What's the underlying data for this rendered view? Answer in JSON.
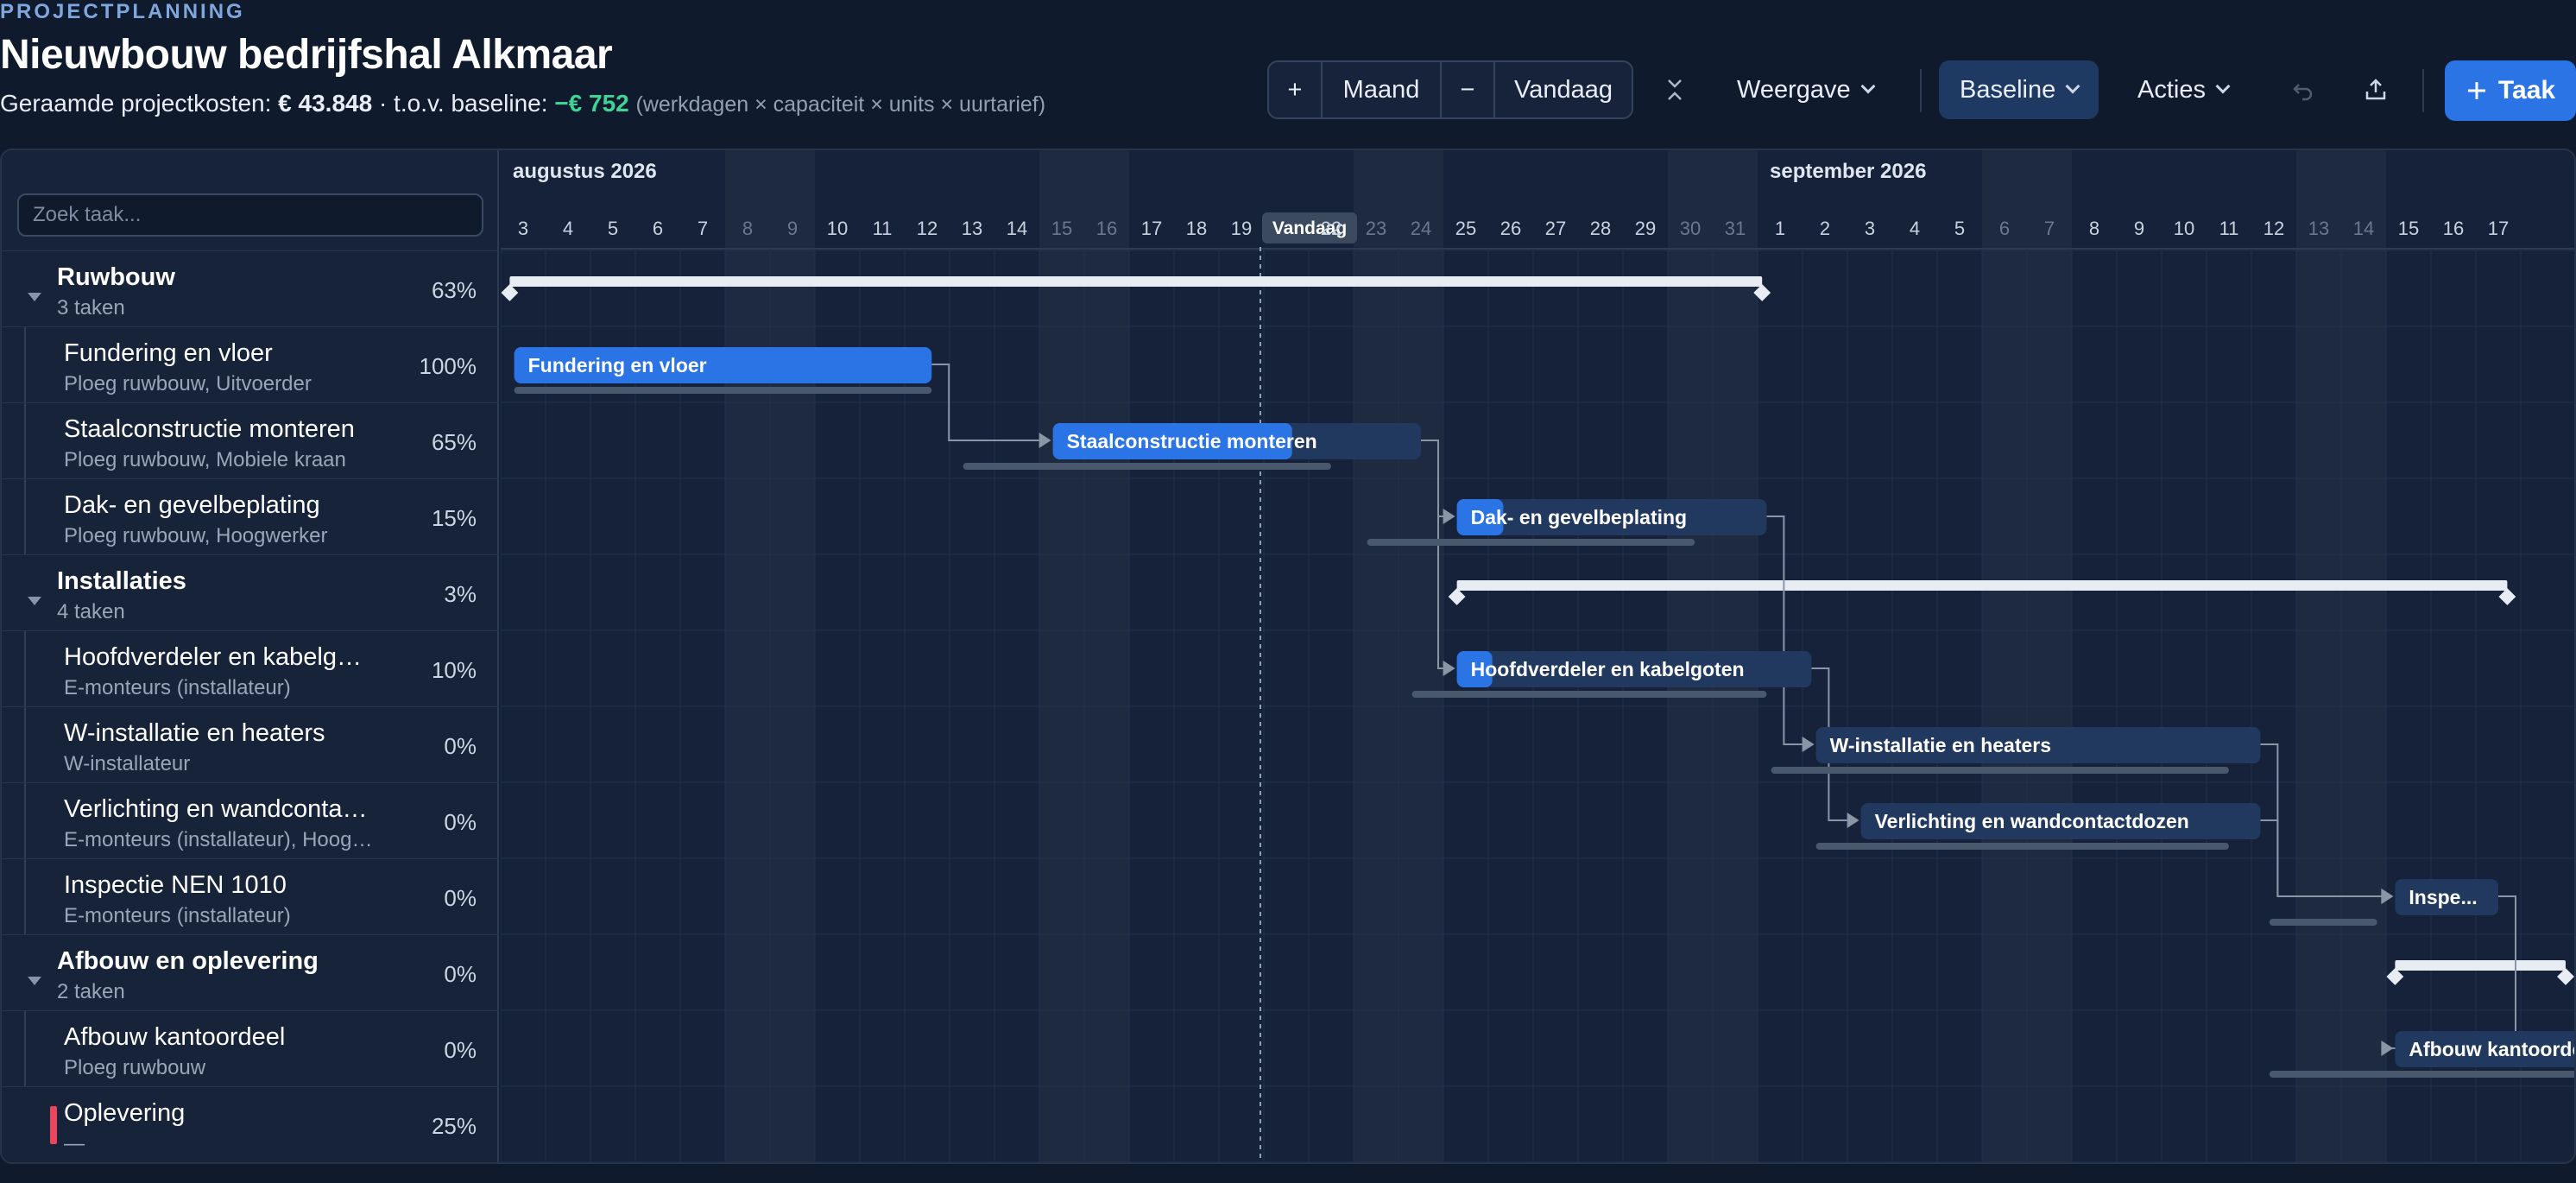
{
  "header": {
    "eyebrow": "PROJECTPLANNING",
    "title": "Nieuwbouw bedrijfshal Alkmaar",
    "cost_label": "Geraamde projectkosten:",
    "cost_value": "€ 43.848",
    "baseline_label": "· t.o.v. baseline:",
    "baseline_delta": "−€ 752",
    "formula": "(werkdagen × capaciteit × units × uurtarief)"
  },
  "toolbar": {
    "zoom_in": "+",
    "scale": "Maand",
    "zoom_out": "−",
    "today": "Vandaag",
    "view": "Weergave",
    "baseline": "Baseline",
    "actions": "Acties",
    "add_task": "Taak"
  },
  "search": {
    "placeholder": "Zoek taak..."
  },
  "timeline": {
    "months": [
      "augustus 2026",
      "september 2026"
    ],
    "days": [
      "3",
      "4",
      "5",
      "6",
      "7",
      "8",
      "9",
      "10",
      "11",
      "12",
      "13",
      "14",
      "15",
      "16",
      "17",
      "18",
      "19",
      "Vandaag",
      "22",
      "23",
      "24",
      "25",
      "26",
      "27",
      "28",
      "29",
      "30",
      "31",
      "1",
      "2",
      "3",
      "4",
      "5",
      "6",
      "7",
      "8",
      "9",
      "10",
      "11",
      "12",
      "13",
      "14",
      "15",
      "16",
      "17"
    ],
    "weekend_day_indices": [
      5,
      6,
      12,
      13,
      19,
      20,
      26,
      27,
      33,
      34,
      40,
      41
    ],
    "today_index": 17
  },
  "rows": [
    {
      "kind": "group",
      "name": "Ruwbouw",
      "sub": "3 taken",
      "pct": "63%"
    },
    {
      "kind": "task",
      "name": "Fundering en vloer",
      "sub": "Ploeg ruwbouw, Uitvoerder",
      "pct": "100%"
    },
    {
      "kind": "task",
      "name": "Staalconstructie monteren",
      "sub": "Ploeg ruwbouw, Mobiele kraan",
      "pct": "65%"
    },
    {
      "kind": "task",
      "name": "Dak- en gevelbeplating",
      "sub": "Ploeg ruwbouw, Hoogwerker",
      "pct": "15%"
    },
    {
      "kind": "group",
      "name": "Installaties",
      "sub": "4 taken",
      "pct": "3%"
    },
    {
      "kind": "task",
      "name": "Hoofdverdeler en kabelgoten",
      "sub": "E-monteurs (installateur)",
      "pct": "10%"
    },
    {
      "kind": "task",
      "name": "W-installatie en heaters",
      "sub": "W-installateur",
      "pct": "0%"
    },
    {
      "kind": "task",
      "name": "Verlichting en wandcontactdozen",
      "sub": "E-monteurs (installateur), Hoogwerker",
      "pct": "0%"
    },
    {
      "kind": "task",
      "name": "Inspectie NEN 1010",
      "sub": "E-monteurs (installateur)",
      "pct": "0%"
    },
    {
      "kind": "group",
      "name": "Afbouw en oplevering",
      "sub": "2 taken",
      "pct": "0%"
    },
    {
      "kind": "task",
      "name": "Afbouw kantoordeel",
      "sub": "Ploeg ruwbouw",
      "pct": "0%"
    },
    {
      "kind": "milestone",
      "name": "Oplevering",
      "sub": "—",
      "pct": "25%"
    }
  ],
  "gantt": {
    "summaries": [
      {
        "row": 0,
        "start": 0.2,
        "end": 28.1
      },
      {
        "row": 4,
        "start": 21.3,
        "end": 44.7
      },
      {
        "row": 9,
        "start": 42.2,
        "end": 46
      }
    ],
    "bars": [
      {
        "row": 1,
        "label": "Fundering en vloer",
        "start": 0.3,
        "end": 9.6,
        "progress": 1.0,
        "base_start": 0.3,
        "base_end": 9.6
      },
      {
        "row": 2,
        "label": "Staalconstructie monteren",
        "start": 12.3,
        "end": 20.5,
        "progress": 0.65,
        "base_start": 10.3,
        "base_end": 18.5
      },
      {
        "row": 3,
        "label": "Dak- en gevelbeplating",
        "start": 21.3,
        "end": 28.2,
        "progress": 0.15,
        "base_start": 19.3,
        "base_end": 26.6
      },
      {
        "row": 5,
        "label": "Hoofdverdeler en kabelgoten",
        "start": 21.3,
        "end": 29.2,
        "progress": 0.1,
        "base_start": 20.3,
        "base_end": 28.2
      },
      {
        "row": 6,
        "label": "W-installatie en heaters",
        "start": 29.3,
        "end": 39.2,
        "progress": 0,
        "base_start": 28.3,
        "base_end": 38.5
      },
      {
        "row": 7,
        "label": "Verlichting en wandcontactdozen",
        "start": 30.3,
        "end": 39.2,
        "progress": 0,
        "base_start": 29.3,
        "base_end": 38.5
      },
      {
        "row": 8,
        "label": "Inspe...",
        "start": 42.2,
        "end": 44.5,
        "progress": 0,
        "base_start": 39.4,
        "base_end": 41.8
      },
      {
        "row": 10,
        "label": "Afbouw kantoordeel",
        "start": 42.2,
        "end": 46.5,
        "progress": 0,
        "base_start": 39.4,
        "base_end": 46.5
      }
    ],
    "links": [
      {
        "from": 1,
        "to": 2
      },
      {
        "from": 2,
        "to": 3
      },
      {
        "from": 2,
        "to": 5
      },
      {
        "from": 3,
        "to": 6
      },
      {
        "from": 5,
        "to": 7
      },
      {
        "from": 6,
        "to": 8
      },
      {
        "from": 7,
        "to": 8
      },
      {
        "from": 8,
        "to": 10
      }
    ]
  },
  "colors": {
    "accent": "#2b74e6",
    "bar_track": "#22395f",
    "baseline": "#4a586e",
    "summary": "#e8edf4",
    "link": "#8a95a6",
    "delta_positive": "#3fd495",
    "milestone": "#e8465f"
  }
}
